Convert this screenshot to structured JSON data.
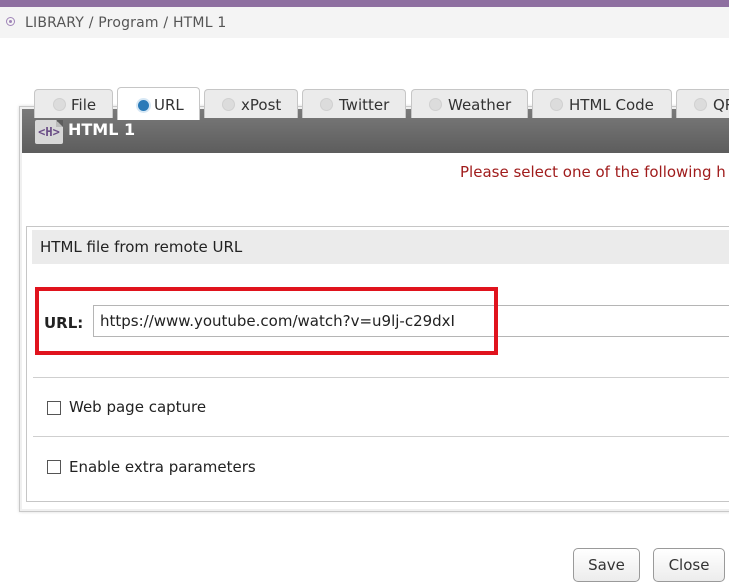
{
  "breadcrumb": {
    "text": "LIBRARY / Program / HTML 1"
  },
  "dialog": {
    "title": "HTML 1",
    "icon_text": "<H>",
    "notice": "Please select one of the following h"
  },
  "tabs": [
    {
      "label": "File",
      "selected": false
    },
    {
      "label": "URL",
      "selected": true
    },
    {
      "label": "xPost",
      "selected": false
    },
    {
      "label": "Twitter",
      "selected": false
    },
    {
      "label": "Weather",
      "selected": false
    },
    {
      "label": "HTML Code",
      "selected": false
    },
    {
      "label": "QR",
      "selected": false
    }
  ],
  "panel": {
    "heading": "HTML file from remote URL",
    "url_label": "URL:",
    "url_value": "https://www.youtube.com/watch?v=u9lj-c29dxI",
    "web_capture_label": "Web page capture",
    "web_capture_checked": false,
    "extra_params_label": "Enable extra parameters",
    "extra_params_checked": false
  },
  "buttons": {
    "save": "Save",
    "close": "Close"
  },
  "colors": {
    "accent": "#8e6fa0",
    "notice": "#a01c1c",
    "highlight": "#e0131d",
    "radio_selected": "#2a7ab8"
  }
}
